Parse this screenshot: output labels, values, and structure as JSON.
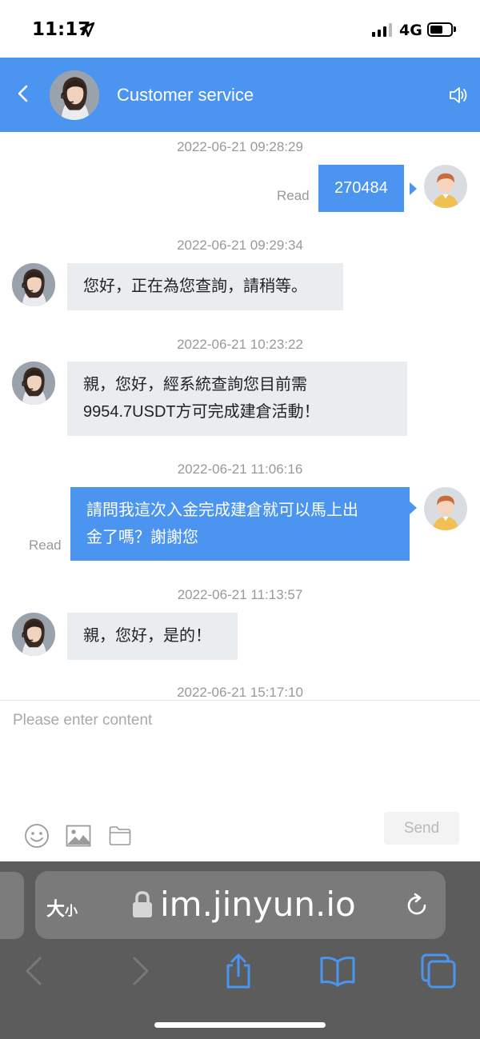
{
  "status_bar": {
    "time": "11:17",
    "network": "4G"
  },
  "header": {
    "title": "Customer service"
  },
  "messages": [
    {
      "time": "2022-06-21 09:28:29",
      "dir": "out",
      "read": "Read",
      "lines": [
        "270484"
      ]
    },
    {
      "time": "2022-06-21 09:29:34",
      "dir": "in",
      "lines": [
        "您好，正在為您查詢，請稍等。"
      ]
    },
    {
      "time": "2022-06-21 10:23:22",
      "dir": "in",
      "lines": [
        "親，您好，經系統查詢您目前需",
        "9954.7USDT方可完成建倉活動！"
      ]
    },
    {
      "time": "2022-06-21 11:06:16",
      "dir": "out",
      "read": "Read",
      "lines": [
        "請問我這次入金完成建倉就可以馬上出",
        "金了嗎？謝謝您"
      ]
    },
    {
      "time": "2022-06-21 11:13:57",
      "dir": "in",
      "lines": [
        "親，您好，是的！"
      ]
    },
    {
      "time": "2022-06-21 15:17:10"
    }
  ],
  "input": {
    "placeholder": "Please enter content",
    "send_label": "Send"
  },
  "browser": {
    "reader_big": "大",
    "reader_small": "小",
    "url": "im.jinyun.io"
  },
  "colors": {
    "accent": "#4b95f1",
    "incoming_bubble": "#eaedf0",
    "browser_bar": "#5c5c5c"
  }
}
